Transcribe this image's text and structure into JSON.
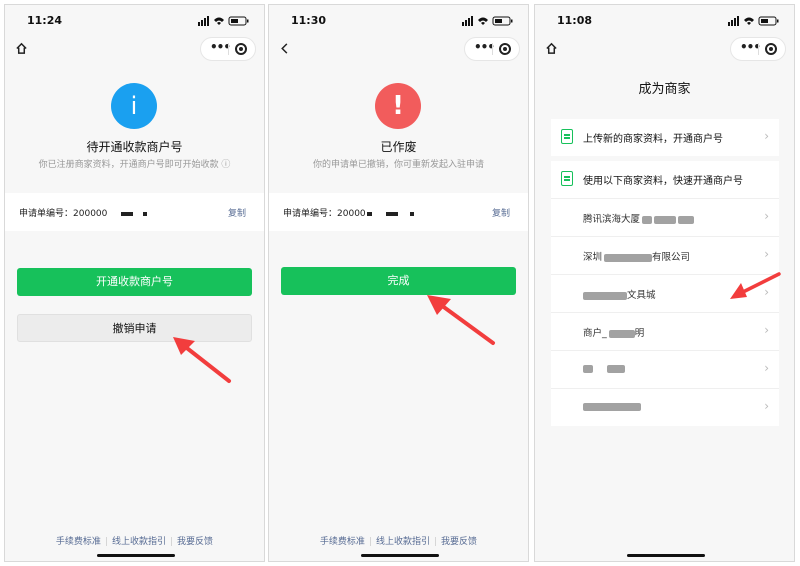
{
  "screens": [
    {
      "time": "11:24",
      "title": "待开通收款商户号",
      "subtitle": "你已注册商家资料，开通商户号即可开始收款 ⓘ",
      "app_no_label": "申请单编号：",
      "app_no_value": "200000",
      "copy_label": "复制",
      "primary_button": "开通收款商户号",
      "secondary_button": "撤销申请",
      "footer": [
        "手续费标准",
        "线上收款指引",
        "我要反馈"
      ],
      "status_icon": "info-icon",
      "status_color": "#1aa0f0"
    },
    {
      "time": "11:30",
      "title": "已作废",
      "subtitle": "你的申请单已撤销，你可重新发起入驻申请",
      "app_no_label": "申请单编号：",
      "app_no_value": "20000",
      "copy_label": "复制",
      "primary_button": "完成",
      "footer": [
        "手续费标准",
        "线上收款指引",
        "我要反馈"
      ],
      "status_icon": "exclamation-icon",
      "status_color": "#f25c5c"
    },
    {
      "time": "11:08",
      "page_title": "成为商家",
      "upload_row": "上传新的商家资料，开通商户号",
      "use_row": "使用以下商家资料，快速开通商户号",
      "merchants": [
        "腾讯滨海大厦",
        "深圳",
        "文具城",
        "商户_",
        "",
        ""
      ],
      "merchant_suffixes": [
        "",
        "有限公司",
        "",
        "明",
        "",
        ""
      ]
    }
  ],
  "accent_green": "#17c15b",
  "link_color": "#586c94"
}
